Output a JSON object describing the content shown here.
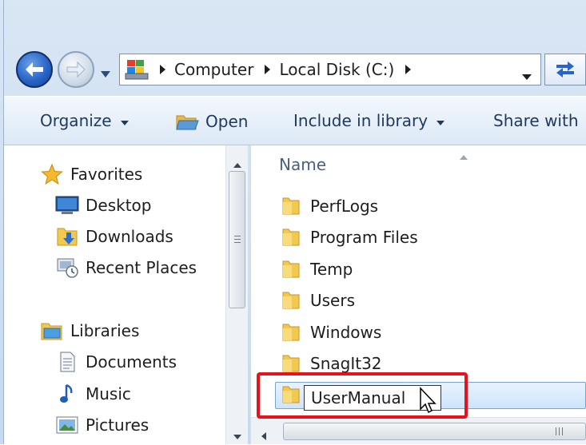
{
  "address": {
    "crumbs": [
      "Computer",
      "Local Disk (C:)"
    ]
  },
  "toolbar": {
    "organize": "Organize",
    "open": "Open",
    "include_in_library": "Include in library",
    "share_with": "Share with"
  },
  "nav": {
    "favorites": {
      "label": "Favorites",
      "icon": "star-icon"
    },
    "favorite_items": [
      {
        "label": "Desktop",
        "icon": "desktop-icon"
      },
      {
        "label": "Downloads",
        "icon": "downloads-folder-icon"
      },
      {
        "label": "Recent Places",
        "icon": "recent-places-icon"
      }
    ],
    "libraries": {
      "label": "Libraries",
      "icon": "libraries-icon"
    },
    "library_items": [
      {
        "label": "Documents",
        "icon": "document-icon"
      },
      {
        "label": "Music",
        "icon": "music-note-icon"
      },
      {
        "label": "Pictures",
        "icon": "pictures-icon"
      }
    ]
  },
  "content": {
    "column_name": "Name",
    "folders": [
      "PerfLogs",
      "Program Files",
      "Temp",
      "Users",
      "Windows",
      "SnagIt32"
    ],
    "rename_value": "UserManual"
  },
  "colors": {
    "highlight": "#e8121c",
    "folder": "#f2c94c",
    "selection": "#cde4fb"
  }
}
